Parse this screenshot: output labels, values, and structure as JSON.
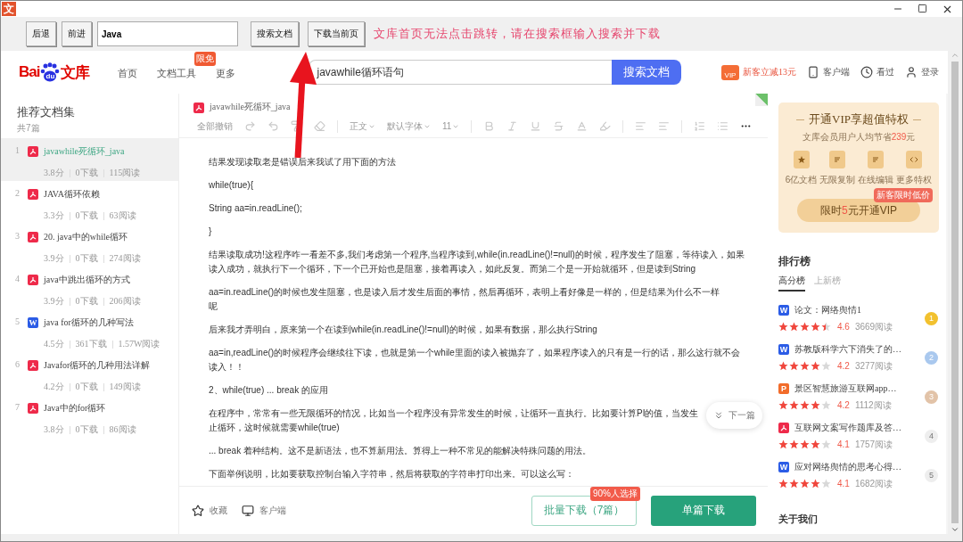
{
  "window": {
    "app_icon": "文"
  },
  "toolbar": {
    "back": "后退",
    "forward": "前进",
    "url_value": "Java",
    "search": "搜索文档",
    "download": "下载当前页",
    "note": "文库首页无法点击跳转，请在搜索框输入搜索并下载"
  },
  "header": {
    "logo": {
      "left": "Bai",
      "paw": "du",
      "right": "文库"
    },
    "nav": [
      {
        "label": "首页"
      },
      {
        "label": "文档工具",
        "badge": "限免"
      },
      {
        "label": "更多"
      }
    ],
    "search": {
      "value": "javawhile循环语句",
      "button": "搜索文档"
    },
    "actions": [
      {
        "kind": "vip",
        "gift": "VIP",
        "label": "新客立减13元"
      },
      {
        "kind": "phone",
        "label": "客户端"
      },
      {
        "kind": "clock",
        "label": "看过"
      },
      {
        "kind": "user",
        "label": "登录"
      }
    ]
  },
  "sidebar": {
    "title": "推荐文档集",
    "count": "共7篇",
    "items": [
      {
        "index": "1",
        "kind": "pdf",
        "title": "javawhile死循环_java",
        "score": "3.8分",
        "downloads": "0下载",
        "reads": "115阅读",
        "selected": true
      },
      {
        "index": "2",
        "kind": "pdf",
        "title": "JAVA循环依赖",
        "score": "3.3分",
        "downloads": "0下载",
        "reads": "63阅读",
        "selected": false
      },
      {
        "index": "3",
        "kind": "pdf",
        "title": "20. java中的while循环",
        "score": "3.9分",
        "downloads": "0下载",
        "reads": "274阅读",
        "selected": false
      },
      {
        "index": "4",
        "kind": "pdf",
        "title": "java中跳出循环的方式",
        "score": "3.9分",
        "downloads": "0下载",
        "reads": "206阅读",
        "selected": false
      },
      {
        "index": "5",
        "kind": "word",
        "icon_label": "W",
        "title": "java for循环的几种写法",
        "score": "4.5分",
        "downloads": "361下载",
        "reads": "1.57W阅读",
        "selected": false
      },
      {
        "index": "6",
        "kind": "pdf",
        "title": "Javafor循环的几种用法详解",
        "score": "4.2分",
        "downloads": "0下载",
        "reads": "149阅读",
        "selected": false
      },
      {
        "index": "7",
        "kind": "pdf",
        "title": "Java中的for循环",
        "score": "3.8分",
        "downloads": "0下载",
        "reads": "86阅读",
        "selected": false
      }
    ]
  },
  "document": {
    "title": "javawhile死循环_java",
    "editor_toolbar": [
      {
        "kind": "text",
        "label": "全部撤销"
      },
      {
        "kind": "redo"
      },
      {
        "kind": "undo"
      },
      {
        "kind": "paint"
      },
      {
        "kind": "eraser"
      },
      {
        "kind": "sep"
      },
      {
        "kind": "dropdown",
        "label": "正文"
      },
      {
        "kind": "dropdown",
        "label": "默认字体"
      },
      {
        "kind": "dropdown",
        "label": "11"
      },
      {
        "kind": "sep"
      },
      {
        "kind": "bold"
      },
      {
        "kind": "italic"
      },
      {
        "kind": "underline"
      },
      {
        "kind": "strike"
      },
      {
        "kind": "color"
      },
      {
        "kind": "highlight"
      },
      {
        "kind": "sep"
      },
      {
        "kind": "align"
      },
      {
        "kind": "lineheight"
      },
      {
        "kind": "sep"
      },
      {
        "kind": "olist"
      },
      {
        "kind": "ulist"
      },
      {
        "kind": "more"
      }
    ],
    "paragraphs": [
      [
        "结果发现读取老是错误后来我试了用下面的方法"
      ],
      [
        "while(true){"
      ],
      [
        "String aa=in.readLine();"
      ],
      [
        "}"
      ],
      [
        "结果读取成功!这程序咋一看差不多,我们考虑第一个程序,当程序读到,while(in.readLine()!=null)的时候，程序发生了阻塞，等待读入，如果",
        "读入成功，就执行下一个循环，下一个已开始也是阻塞，接着再读入，如此反复。而第二个是一开始就循环，但是读到String"
      ],
      [
        "aa=in.readLine()的时候也发生阻塞，也是读入后才发生后面的事情，然后再循环，表明上看好像是一样的，但是结果为什么不一样",
        "呢"
      ],
      [
        "后来我才弄明白，原来第一个在读到while(in.readLine()!=null)的时候，如果有数据，那么执行String"
      ],
      [
        "aa=in,readLine()的时候程序会继续往下读，也就是第一个while里面的读入被抛弃了，如果程序读入的只有是一行的话，那么这行就不会",
        "读入！！"
      ],
      [
        "2、while(true) ... break 的应用"
      ],
      [
        "在程序中，常常有一些无限循环的情况，比如当一个程序没有异常发生的时候，让循环一直执行。比如要计算PI的值，当发生",
        "止循环，这时候就需要while(true)"
      ],
      [
        "... break 着种结构。这不是新语法，也不算新用法。算得上一种不常见的能解决特殊问题的用法。"
      ],
      [
        "下面举例说明，比如要获取控制台输入字符串，然后将获取的字符串打印出来。可以这么写："
      ]
    ],
    "next": "下一篇",
    "bottom": {
      "favorite": "收藏",
      "client": "客户端",
      "batch": "批量下载（7篇）",
      "batch_badge": "90%人选择",
      "single": "单篇下载"
    }
  },
  "vip_card": {
    "title": "开通VIP享超值特权",
    "subtitle": {
      "before": "文库会员用户人均节省",
      "amount": "239",
      "after": "元"
    },
    "features": [
      {
        "kind": "star",
        "label": "6亿文档"
      },
      {
        "kind": "copy",
        "label": "无限复制"
      },
      {
        "kind": "edit",
        "label": "在线编辑"
      },
      {
        "kind": "code",
        "label": "更多特权"
      }
    ],
    "button": {
      "before": "限时",
      "amount": "5",
      "after": "元开通VIP"
    },
    "badge": "新客限时低价"
  },
  "ranking": {
    "title": "排行榜",
    "tabs": [
      {
        "label": "高分榜",
        "selected": true
      },
      {
        "label": "上新榜",
        "selected": false
      }
    ],
    "items": [
      {
        "kind": "word",
        "icon_label": "W",
        "title": "论文：网络舆情1",
        "stars": 4.5,
        "rating": "4.6",
        "reads": "3669阅读",
        "rank": "1",
        "color": "#f2c12e"
      },
      {
        "kind": "word",
        "icon_label": "W",
        "title": "苏教版科学六下消失了的…",
        "stars": 4,
        "rating": "4.2",
        "reads": "3277阅读",
        "rank": "2",
        "color": "#a9c8ee"
      },
      {
        "kind": "ppt",
        "icon_label": "P",
        "title": "景区智慧旅游互联网app…",
        "stars": 4,
        "rating": "4.2",
        "reads": "1112阅读",
        "rank": "3",
        "color": "#e2c3a8"
      },
      {
        "kind": "pdf",
        "title": "互联网文案写作题库及答…",
        "stars": 4,
        "rating": "4.1",
        "reads": "1757阅读",
        "rank": "4",
        "color": "#eeeeee"
      },
      {
        "kind": "word",
        "icon_label": "W",
        "title": "应对网络舆情的思考心得…",
        "stars": 4,
        "rating": "4.1",
        "reads": "1682阅读",
        "rank": "5",
        "color": "#eeeeee"
      }
    ]
  },
  "about": "关于我们"
}
